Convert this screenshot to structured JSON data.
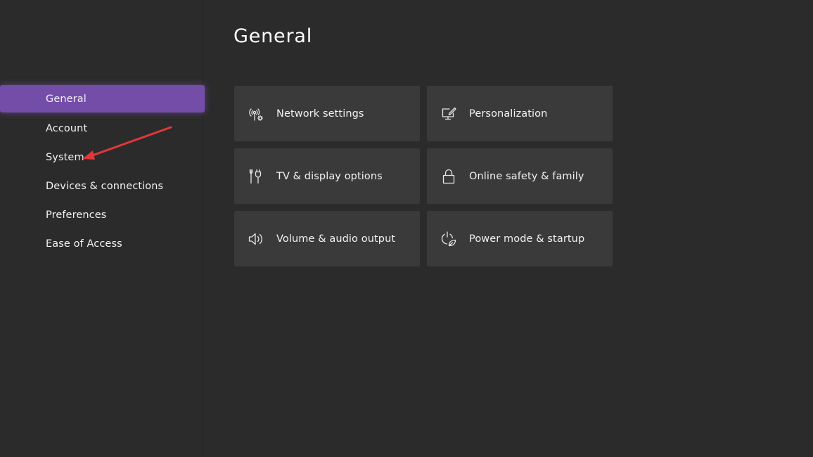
{
  "colors": {
    "background": "#2b2b2b",
    "tile": "#3a3a3a",
    "accent": "#744da9",
    "annotation_arrow": "#e0373a"
  },
  "page": {
    "title": "General"
  },
  "sidebar": {
    "items": [
      {
        "label": "General",
        "selected": true
      },
      {
        "label": "Account",
        "selected": false
      },
      {
        "label": "System",
        "selected": false
      },
      {
        "label": "Devices & connections",
        "selected": false
      },
      {
        "label": "Preferences",
        "selected": false
      },
      {
        "label": "Ease of Access",
        "selected": false
      }
    ]
  },
  "tiles": [
    {
      "label": "Network settings",
      "icon": "network-settings-icon"
    },
    {
      "label": "Personalization",
      "icon": "personalization-icon"
    },
    {
      "label": "TV & display options",
      "icon": "tv-display-icon"
    },
    {
      "label": "Online safety & family",
      "icon": "lock-icon"
    },
    {
      "label": "Volume & audio output",
      "icon": "speaker-icon"
    },
    {
      "label": "Power mode & startup",
      "icon": "power-leaf-icon"
    }
  ]
}
